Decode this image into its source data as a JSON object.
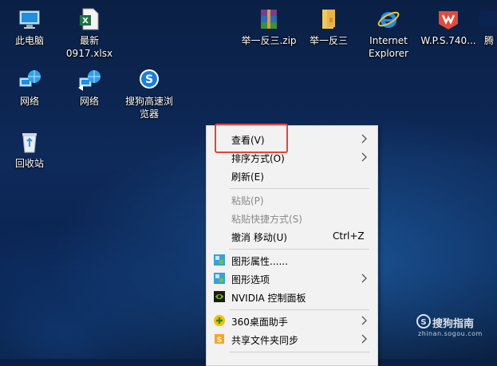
{
  "desktop": {
    "icons": [
      {
        "label": "此电脑",
        "icon": "computer-icon"
      },
      {
        "label": "最新\n0917.xlsx",
        "icon": "excel-file-icon"
      },
      {
        "label": "举一反三.zip",
        "icon": "winrar-archive-icon"
      },
      {
        "label": "举一反三",
        "icon": "folder-icon"
      },
      {
        "label": "Internet\nExplorer",
        "icon": "internet-explorer-icon"
      },
      {
        "label": "W.P.S.740...",
        "icon": "wps-icon"
      },
      {
        "label": "腾",
        "icon": "tencent-icon"
      },
      {
        "label": "网络",
        "icon": "network-icon"
      },
      {
        "label": "网络",
        "icon": "network-icon"
      },
      {
        "label": "搜狗高速浏\n览器",
        "icon": "sogou-browser-icon"
      },
      {
        "label": "回收站",
        "icon": "recycle-bin-icon"
      }
    ]
  },
  "context_menu": {
    "items": {
      "view": {
        "label": "查看(V)",
        "has_submenu": true
      },
      "sort": {
        "label": "排序方式(O)",
        "has_submenu": true
      },
      "refresh": {
        "label": "刷新(E)"
      },
      "paste": {
        "label": "粘贴(P)",
        "disabled": true
      },
      "paste_shortcut": {
        "label": "粘贴快捷方式(S)",
        "disabled": true
      },
      "undo_move": {
        "label": "撤消 移动(U)",
        "shortcut": "Ctrl+Z"
      },
      "graphics_properties": {
        "label": "图形属性......",
        "icon": "intel-graphics-icon"
      },
      "graphics_options": {
        "label": "图形选项",
        "icon": "intel-graphics-icon",
        "has_submenu": true
      },
      "nvidia": {
        "label": "NVIDIA 控制面板",
        "icon": "nvidia-icon"
      },
      "desktop_helper": {
        "label": "360桌面助手",
        "icon": "360-icon",
        "has_submenu": true
      },
      "share_sync": {
        "label": "共享文件夹同步",
        "icon": "share-sync-icon",
        "has_submenu": true
      }
    }
  },
  "watermark": {
    "title": "搜狗指南",
    "subtitle": "zhinan.sogou.com"
  },
  "colors": {
    "highlight_border": "#e0443e",
    "menu_bg": "#f2f2f2",
    "disabled_text": "#8a8a8a"
  }
}
